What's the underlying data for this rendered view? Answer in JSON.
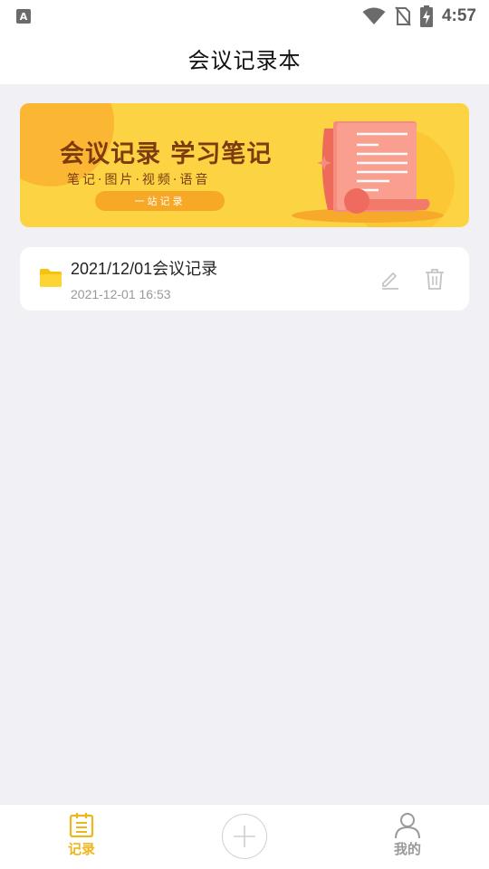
{
  "status_bar": {
    "left_badge": "A",
    "time": "4:57",
    "icons": [
      "wifi-icon",
      "no-sim-icon",
      "battery-charging-icon"
    ]
  },
  "header": {
    "title": "会议记录本"
  },
  "banner": {
    "title": "会议记录 学习笔记",
    "subtitle": "笔记·图片·视频·语音",
    "pill": "一站记录"
  },
  "records": [
    {
      "icon": "folder-icon",
      "title": "2021/12/01会议记录",
      "time": "2021-12-01 16:53",
      "actions": [
        "edit-icon",
        "trash-icon"
      ]
    }
  ],
  "bottom_nav": {
    "items": [
      {
        "label": "记录",
        "icon": "notebook-icon",
        "active": true
      },
      {
        "label": "",
        "icon": "plus-icon",
        "active": false
      },
      {
        "label": "我的",
        "icon": "person-icon",
        "active": false
      }
    ]
  },
  "colors": {
    "accent": "#f0b51c",
    "background": "#f1f1f5",
    "banner": "#fcd443",
    "banner_text": "#7d3b10"
  }
}
